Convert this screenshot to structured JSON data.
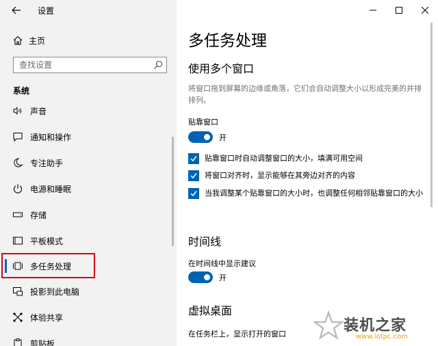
{
  "window": {
    "title": "设置"
  },
  "sidebar": {
    "home_label": "主页",
    "search_placeholder": "查找设置",
    "section_label": "系统",
    "items": [
      {
        "label": "声音",
        "icon": "speaker-icon"
      },
      {
        "label": "通知和操作",
        "icon": "notification-icon"
      },
      {
        "label": "专注助手",
        "icon": "moon-icon"
      },
      {
        "label": "电源和睡眠",
        "icon": "power-icon"
      },
      {
        "label": "存储",
        "icon": "storage-icon"
      },
      {
        "label": "平板模式",
        "icon": "tablet-icon"
      },
      {
        "label": "多任务处理",
        "icon": "multitask-icon",
        "selected": true
      },
      {
        "label": "投影到此电脑",
        "icon": "projector-icon"
      },
      {
        "label": "体验共享",
        "icon": "share-icon"
      },
      {
        "label": "剪贴板",
        "icon": "clipboard-icon"
      }
    ]
  },
  "main": {
    "page_title": "多任务处理",
    "snap": {
      "heading": "使用多个窗口",
      "description": "将窗口拖到屏幕的边缘或角落，它们会自动调整大小以形成完美的并排排列。",
      "toggle_label": "贴靠窗口",
      "toggle_state": "开",
      "checkboxes": [
        {
          "label": "贴靠窗口时自动调整窗口的大小，填满可用空间",
          "checked": true
        },
        {
          "label": "将窗口对齐时，显示能够在其旁边对齐的内容",
          "checked": true
        },
        {
          "label": "当我调整某个贴靠窗口的大小时，也调整任何相邻贴靠窗口的大小",
          "checked": true
        }
      ]
    },
    "timeline": {
      "heading": "时间线",
      "toggle_label": "在时间线中显示建议",
      "toggle_state": "开"
    },
    "virtual_desktops": {
      "heading": "虚拟桌面",
      "taskbar_label": "在任务栏上，显示打开的窗口"
    }
  },
  "watermark": {
    "text": "装机之家",
    "url": "www.lotpc.com"
  },
  "colors": {
    "accent": "#0063b1",
    "sidebar_bg": "#f2f2f2",
    "highlight_box": "#d0021b"
  }
}
